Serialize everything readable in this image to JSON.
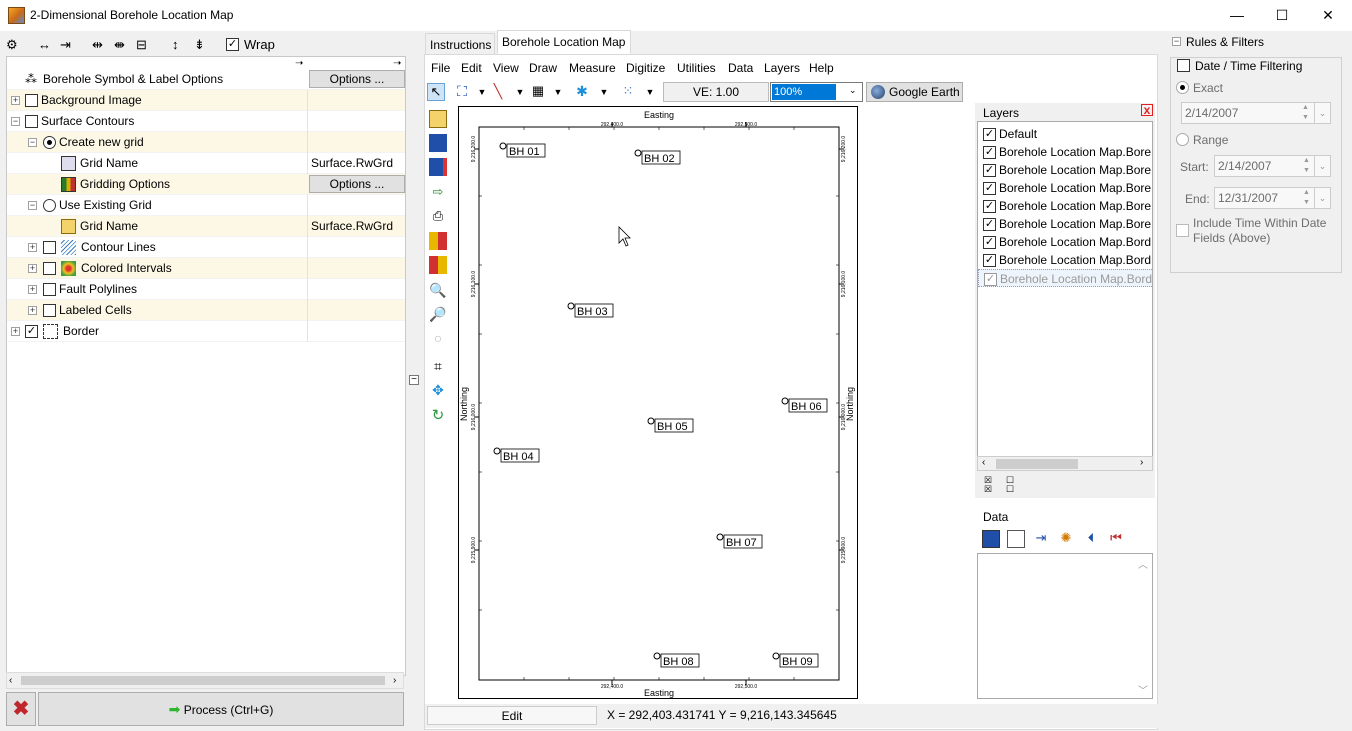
{
  "window": {
    "title": "2-Dimensional Borehole Location Map",
    "minimize": "—",
    "maximize": "☐",
    "close": "✕"
  },
  "left_toolbar": {
    "wrap_label": "Wrap",
    "wrap_checked": true
  },
  "tree": {
    "rows": [
      {
        "label": "Borehole Symbol & Label Options",
        "button": "Options ..."
      },
      {
        "label": "Background Image"
      },
      {
        "label": "Surface Contours"
      },
      {
        "label": "Create new grid"
      },
      {
        "label": "Grid Name",
        "value": "Surface.RwGrd"
      },
      {
        "label": "Gridding Options",
        "button": "Options ..."
      },
      {
        "label": "Use Existing Grid"
      },
      {
        "label": "Grid Name",
        "value": "Surface.RwGrd"
      },
      {
        "label": "Contour Lines"
      },
      {
        "label": "Colored Intervals"
      },
      {
        "label": "Fault Polylines"
      },
      {
        "label": "Labeled Cells"
      },
      {
        "label": "Border"
      }
    ]
  },
  "process_button": "Process (Ctrl+G)",
  "tabs": [
    {
      "label": "Instructions"
    },
    {
      "label": "Borehole Location Map"
    }
  ],
  "menu": [
    "File",
    "Edit",
    "View",
    "Draw",
    "Measure",
    "Digitize",
    "Utilities",
    "Data",
    "Layers",
    "Help"
  ],
  "toolbar": {
    "ve": "VE: 1.00",
    "zoom": "100%",
    "google_earth": "Google Earth"
  },
  "map": {
    "easting_label": "Easting",
    "northing_label": "Northing",
    "x_ticks": [
      "292,400.0",
      "292,500.0"
    ],
    "y_ticks": [
      "9,216,200.0",
      "9,216,100.0",
      "9,216,000.0",
      "9,215,900.0"
    ],
    "boreholes": [
      "BH 01",
      "BH 02",
      "BH 03",
      "BH 04",
      "BH 05",
      "BH 06",
      "BH 07",
      "BH 08",
      "BH 09"
    ]
  },
  "layers": {
    "title": "Layers",
    "items": [
      "Default",
      "Borehole Location Map.Bore",
      "Borehole Location Map.Bore",
      "Borehole Location Map.Bore",
      "Borehole Location Map.Bore",
      "Borehole Location Map.Bore",
      "Borehole Location Map.Bord",
      "Borehole Location Map.Bord",
      "Borehole Location Map.Bord"
    ]
  },
  "data_panel": {
    "title": "Data"
  },
  "rules": {
    "title": "Rules & Filters",
    "date_filter": "Date / Time Filtering",
    "exact": "Exact",
    "exact_date": "2/14/2007",
    "range": "Range",
    "start_label": "Start:",
    "start_date": "2/14/2007",
    "end_label": "End:",
    "end_date": "12/31/2007",
    "include_line1": "Include Time Within Date",
    "include_line2": "Fields (Above)"
  },
  "status": {
    "mode": "Edit",
    "coords": "X = 292,403.431741  Y = 9,216,143.345645"
  }
}
